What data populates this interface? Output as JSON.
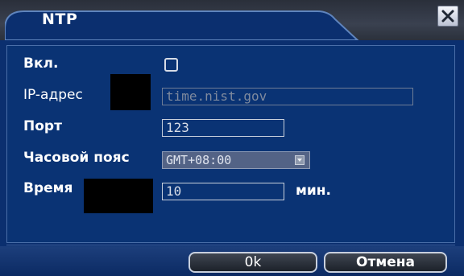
{
  "window": {
    "title": "NTP",
    "close_label": "×"
  },
  "form": {
    "enable_label": "Вкл.",
    "enable_checked": false,
    "ip_label": "IP-адрес",
    "ip_value": "time.nist.gov",
    "port_label": "Порт",
    "port_value": "123",
    "timezone_label": "Часовой пояс",
    "timezone_value": "GMT+08:00",
    "time_label": "Время",
    "time_value": "10",
    "time_unit": "мин."
  },
  "buttons": {
    "ok_label": "0k",
    "cancel_label": "Отмена"
  },
  "colors": {
    "panel": "#0b2f6f",
    "titlebar": "#2f3542",
    "text": "#ffffff"
  }
}
